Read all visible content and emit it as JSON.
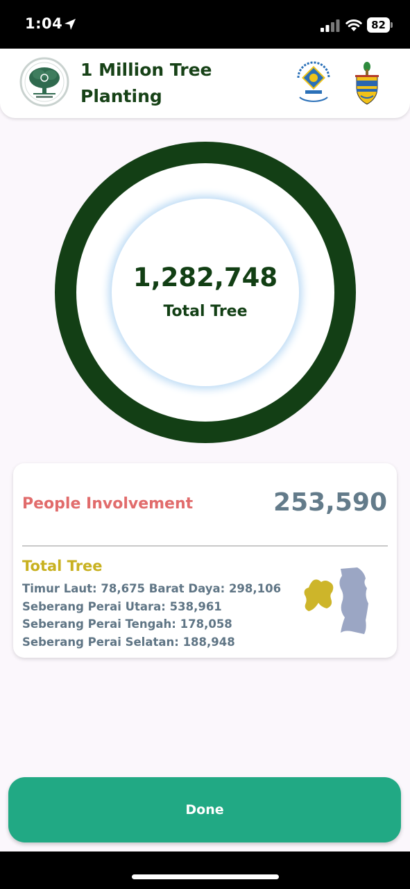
{
  "status_bar": {
    "time": "1:04",
    "battery": "82"
  },
  "header": {
    "title": "1 Million Tree Planting"
  },
  "summary": {
    "total_value": "1,282,748",
    "total_label": "Total Tree"
  },
  "stats": {
    "involvement_label": "People Involvement",
    "involvement_value": "253,590",
    "tree_heading": "Total Tree",
    "district_lines": [
      "Timur Laut: 78,675 Barat Daya: 298,106",
      "Seberang Perai Utara: 538,961",
      "Seberang Perai Tengah: 178,058",
      "Seberang Perai Selatan: 188,948"
    ]
  },
  "actions": {
    "done_label": "Done"
  },
  "colors": {
    "ring": "#133f15",
    "involvement": "#e16c6c",
    "tree_heading": "#c8b120",
    "stat_text": "#5f7585",
    "button": "#21a984",
    "map_island": "#cdb52a",
    "map_mainland": "#9ba6c4"
  },
  "icons": [
    "location-arrow-icon",
    "cellular-signal-icon",
    "wifi-icon",
    "battery-icon",
    "co2-tree-logo",
    "tyt-logo",
    "penang-crest-logo",
    "penang-map-icon"
  ]
}
